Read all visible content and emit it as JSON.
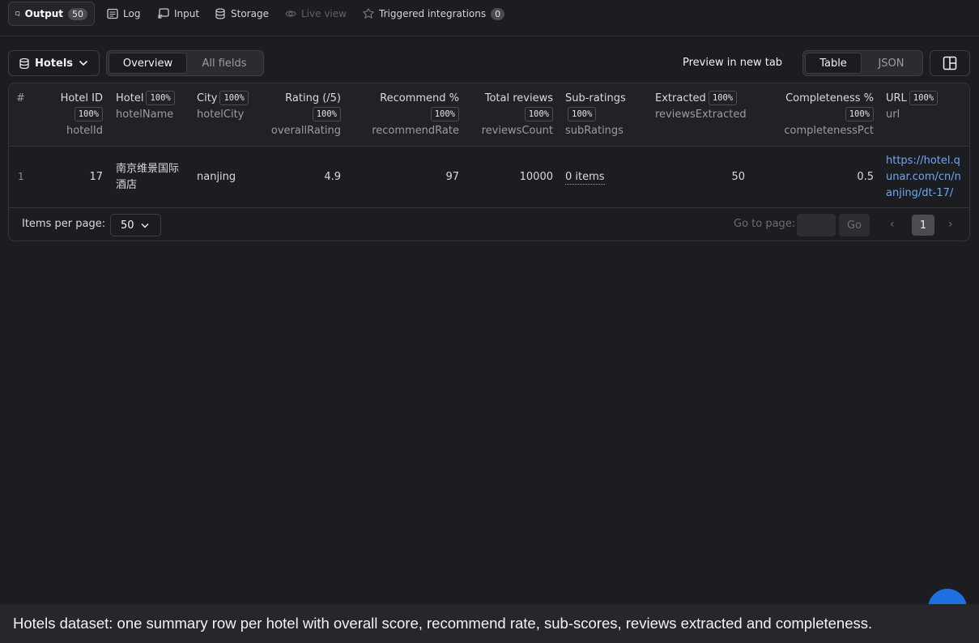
{
  "tabs": {
    "output_label": "Output",
    "output_count": "50",
    "log_label": "Log",
    "input_label": "Input",
    "storage_label": "Storage",
    "live_view_label": "Live view",
    "integrations_label": "Triggered integrations",
    "integrations_count": "0"
  },
  "toolbar": {
    "dataset_label": "Hotels",
    "view_overview": "Overview",
    "view_all_fields": "All fields",
    "preview_link": "Preview in new tab",
    "format_table": "Table",
    "format_json": "JSON"
  },
  "table": {
    "columns": [
      {
        "label": "#",
        "pct": "",
        "field": ""
      },
      {
        "label": "Hotel ID",
        "pct": "100%",
        "field": "hotelId"
      },
      {
        "label": "Hotel",
        "pct": "100%",
        "field": "hotelName"
      },
      {
        "label": "City",
        "pct": "100%",
        "field": "hotelCity"
      },
      {
        "label": "Rating (/5)",
        "pct": "100%",
        "field": "overallRating"
      },
      {
        "label": "Recommend %",
        "pct": "100%",
        "field": "recommendRate"
      },
      {
        "label": "Total reviews",
        "pct": "100%",
        "field": "reviewsCount"
      },
      {
        "label": "Sub-ratings",
        "pct": "100%",
        "field": "subRatings"
      },
      {
        "label": "Extracted",
        "pct": "100%",
        "field": "reviewsExtracted"
      },
      {
        "label": "Completeness %",
        "pct": "100%",
        "field": "completenessPct"
      },
      {
        "label": "URL",
        "pct": "100%",
        "field": "url"
      }
    ],
    "rows": [
      {
        "index": "1",
        "hotelId": "17",
        "hotelName": "南京维景国际酒店",
        "hotelCity": "nanjing",
        "overallRating": "4.9",
        "recommendRate": "97",
        "reviewsCount": "10000",
        "subRatings": "0 items",
        "reviewsExtracted": "50",
        "completenessPct": "0.5",
        "url": "https://hotel.qunar.com/cn/nanjing/dt-17/"
      }
    ]
  },
  "pagination": {
    "items_per_page_label": "Items per page:",
    "items_per_page_value": "50",
    "goto_label": "Go to page:",
    "go_button": "Go",
    "current_page": "1",
    "prev_symbol": "‹",
    "next_symbol": "›"
  },
  "caption": "Hotels dataset: one summary row per hotel with overall score, recommend rate, sub-scores, reviews extracted and completeness.",
  "colors": {
    "background": "#1c1d20",
    "link": "#6fa6f5",
    "accent": "#1f6fe0"
  }
}
